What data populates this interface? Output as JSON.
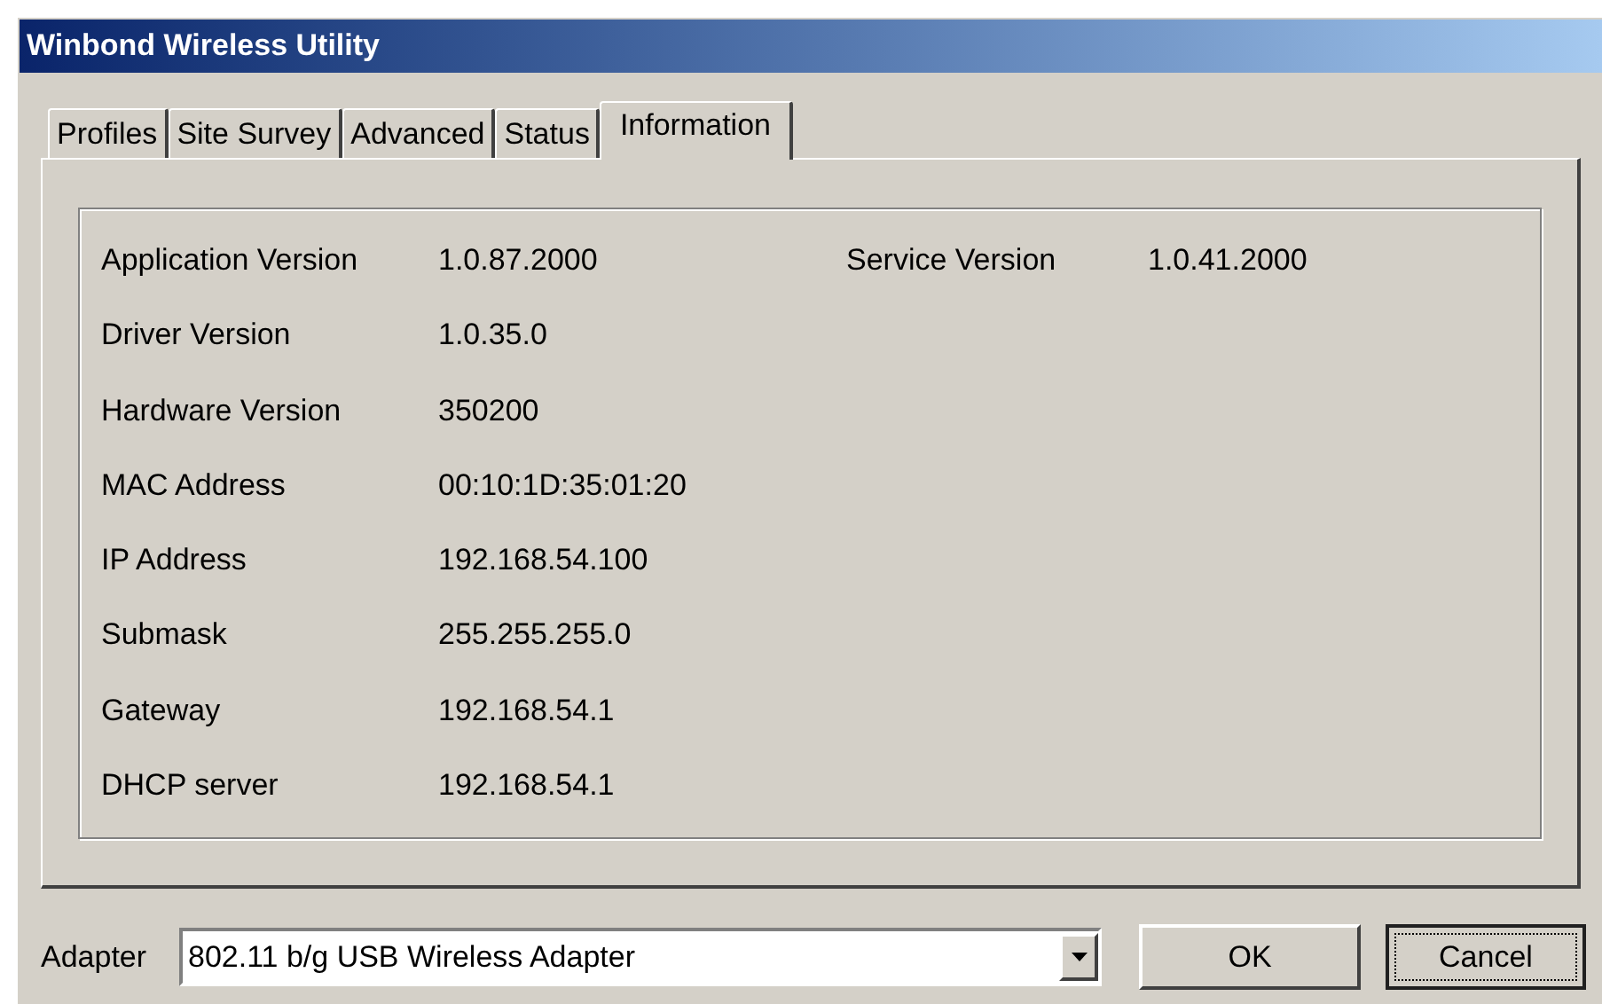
{
  "window": {
    "title": "Winbond Wireless Utility"
  },
  "tabs": [
    {
      "label": "Profiles",
      "selected": false
    },
    {
      "label": "Site Survey",
      "selected": false
    },
    {
      "label": "Advanced",
      "selected": false
    },
    {
      "label": "Status",
      "selected": false
    },
    {
      "label": "Information",
      "selected": true
    }
  ],
  "info_left": [
    {
      "label": "Application Version",
      "value": "1.0.87.2000"
    },
    {
      "label": "Driver Version",
      "value": "1.0.35.0"
    },
    {
      "label": "Hardware Version",
      "value": "350200"
    },
    {
      "label": "MAC Address",
      "value": "00:10:1D:35:01:20"
    },
    {
      "label": "IP Address",
      "value": "192.168.54.100"
    },
    {
      "label": "Submask",
      "value": "255.255.255.0"
    },
    {
      "label": "Gateway",
      "value": "192.168.54.1"
    },
    {
      "label": "DHCP server",
      "value": "192.168.54.1"
    }
  ],
  "info_right": [
    {
      "label": "Service Version",
      "value": "1.0.41.2000"
    }
  ],
  "adapter": {
    "label": "Adapter",
    "value": "802.11 b/g USB Wireless Adapter"
  },
  "buttons": [
    {
      "label": "OK",
      "default": false
    },
    {
      "label": "Cancel",
      "default": true
    }
  ]
}
